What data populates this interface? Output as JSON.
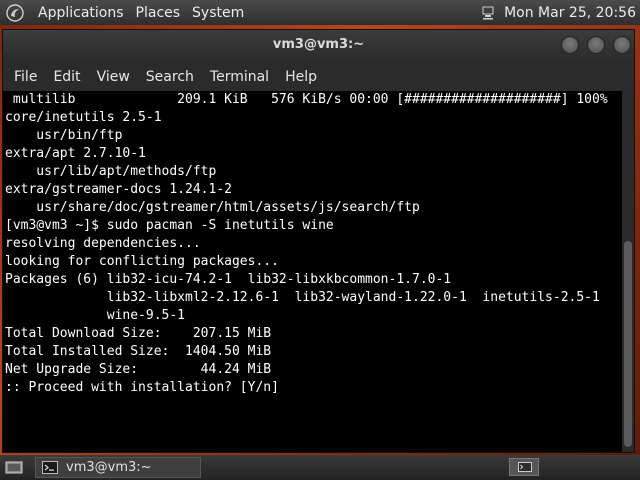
{
  "top_panel": {
    "menus": [
      "Applications",
      "Places",
      "System"
    ],
    "clock": "Mon Mar 25, 20:56",
    "icons": {
      "logo": "distro-logo-icon",
      "tray": "network-icon"
    }
  },
  "window": {
    "title": "vm3@vm3:~",
    "menu": [
      "File",
      "Edit",
      "View",
      "Search",
      "Terminal",
      "Help"
    ],
    "controls": [
      "minimize-icon",
      "maximize-icon",
      "close-icon"
    ]
  },
  "terminal": {
    "lines": [
      " multilib             209.1 KiB   576 KiB/s 00:00 [####################] 100%",
      "core/inetutils 2.5-1",
      "    usr/bin/ftp",
      "extra/apt 2.7.10-1",
      "    usr/lib/apt/methods/ftp",
      "extra/gstreamer-docs 1.24.1-2",
      "    usr/share/doc/gstreamer/html/assets/js/search/ftp",
      "[vm3@vm3 ~]$ sudo pacman -S inetutils wine",
      "resolving dependencies...",
      "looking for conflicting packages...",
      "",
      "Packages (6) lib32-icu-74.2-1  lib32-libxkbcommon-1.7.0-1",
      "             lib32-libxml2-2.12.6-1  lib32-wayland-1.22.0-1  inetutils-2.5-1",
      "             wine-9.5-1",
      "",
      "Total Download Size:    207.15 MiB",
      "Total Installed Size:  1404.50 MiB",
      "Net Upgrade Size:        44.24 MiB",
      "",
      ":: Proceed with installation? [Y/n]"
    ]
  },
  "bottom_panel": {
    "task_label": "vm3@vm3:~",
    "icons": {
      "show_desktop": "show-desktop-icon",
      "task": "terminal-icon",
      "workspace": "workspace-switcher-icon"
    }
  }
}
